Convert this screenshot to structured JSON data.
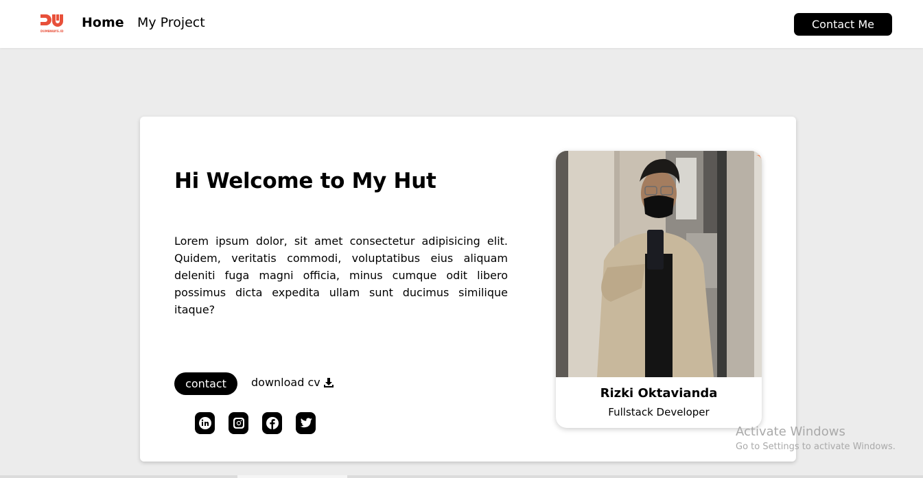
{
  "navbar": {
    "logo_text": "DUMBWAYS.ID",
    "links": [
      {
        "label": "Home"
      },
      {
        "label": "My Project"
      }
    ],
    "contact_label": "Contact Me"
  },
  "hero": {
    "title": "Hi Welcome to My Hut",
    "description": "Lorem ipsum dolor, sit amet consectetur adipisicing elit. Quidem, veritatis commodi, voluptatibus eius aliquam deleniti fuga magni officia, minus cumque odit libero possimus dicta expedita ullam sunt ducimus similique itaque?",
    "contact_button": "contact",
    "download_label": "download cv",
    "download_icon": "download-icon",
    "socials": [
      {
        "name": "linkedin-icon"
      },
      {
        "name": "instagram-icon"
      },
      {
        "name": "facebook-icon"
      },
      {
        "name": "twitter-icon"
      }
    ]
  },
  "profile": {
    "name": "Rizki Oktavianda",
    "role": "Fullstack Developer"
  },
  "watermark": {
    "title": "Activate Windows",
    "subtitle": "Go to Settings to activate Windows."
  },
  "colors": {
    "brand": "#e8503a",
    "background": "#ececec",
    "button": "#000000"
  }
}
